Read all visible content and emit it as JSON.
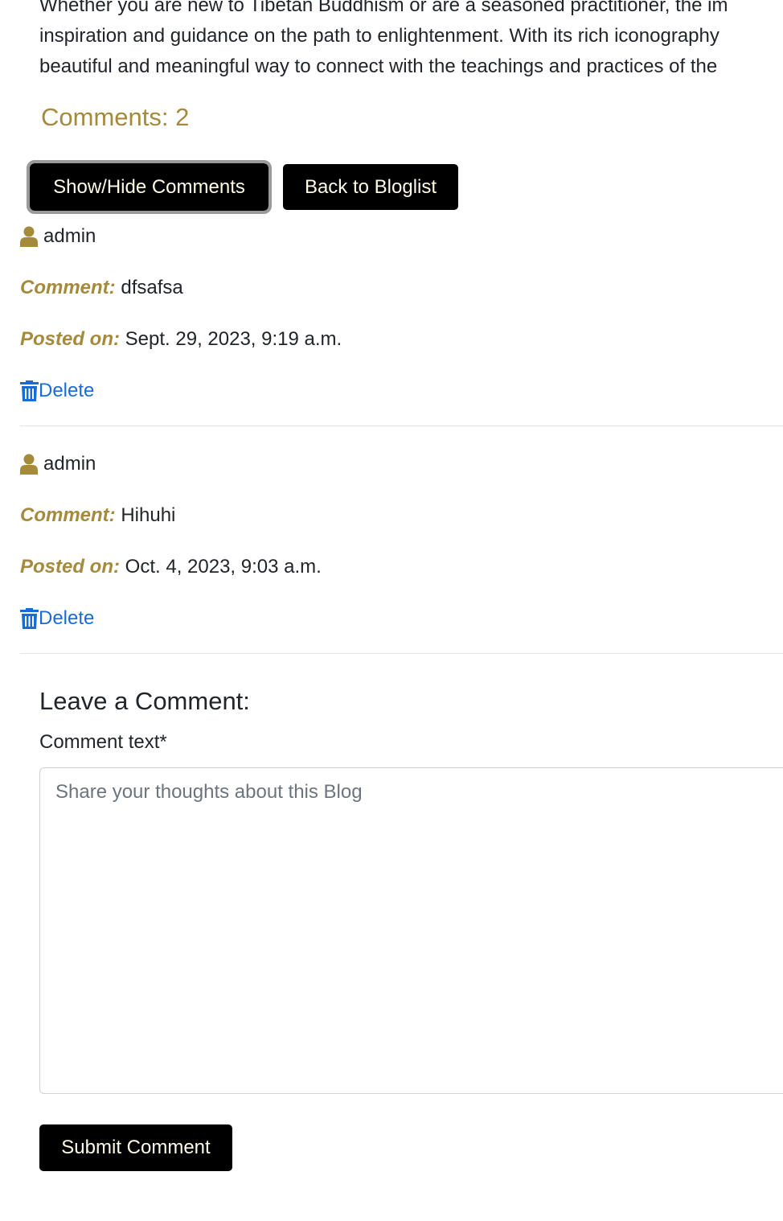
{
  "post": {
    "intro_lines": [
      "Whether you are new to Tibetan Buddhism or are a seasoned practitioner, the im",
      "inspiration and guidance on the path to enlightenment. With its rich iconography",
      "beautiful and meaningful way to connect with the teachings and practices of the"
    ]
  },
  "comments_section": {
    "count_label": "Comments: 2",
    "toggle_button_label": "Show/Hide Comments",
    "back_button_label": "Back to Bloglist",
    "comment_label": "Comment:",
    "posted_label": "Posted on:",
    "delete_label": "Delete",
    "items": [
      {
        "author": "admin",
        "text": "dfsafsa",
        "posted_on": "Sept. 29, 2023, 9:19 a.m."
      },
      {
        "author": "admin",
        "text": "Hihuhi",
        "posted_on": "Oct. 4, 2023, 9:03 a.m."
      }
    ]
  },
  "comment_form": {
    "title": "Leave a Comment:",
    "field_label": "Comment text*",
    "placeholder": "Share your thoughts about this Blog",
    "value": "",
    "submit_label": "Submit Comment"
  },
  "colors": {
    "accent_gold": "#a68a3c",
    "link_blue": "#1a6bd8",
    "button_black": "#000000"
  },
  "icons": {
    "user": "user-icon",
    "delete": "trash-icon"
  }
}
